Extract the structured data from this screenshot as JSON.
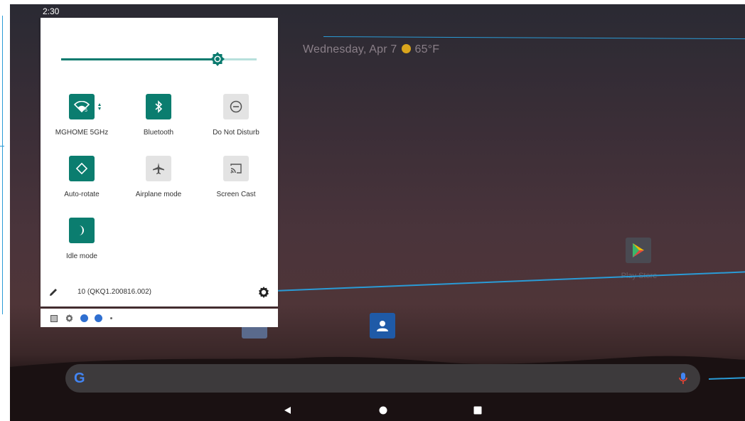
{
  "status_bar": {
    "time": "2:30"
  },
  "home": {
    "date_weather": "Wednesday, Apr 7",
    "temperature": "65°F",
    "apps": [
      {
        "label": "Play Store"
      }
    ]
  },
  "quick_settings": {
    "brightness_level": 0.8,
    "tiles": [
      {
        "label": "MGHOME 5GHz",
        "icon": "wifi-icon",
        "state": "on"
      },
      {
        "label": "Bluetooth",
        "icon": "bluetooth-icon",
        "state": "on"
      },
      {
        "label": "Do Not Disturb",
        "icon": "dnd-icon",
        "state": "off"
      },
      {
        "label": "Auto-rotate",
        "icon": "rotate-icon",
        "state": "on"
      },
      {
        "label": "Airplane mode",
        "icon": "airplane-icon",
        "state": "off"
      },
      {
        "label": "Screen Cast",
        "icon": "cast-icon",
        "state": "off"
      },
      {
        "label": "Idle mode",
        "icon": "moon-icon",
        "state": "on"
      }
    ],
    "build_number": "10 (QKQ1.200816.002)"
  },
  "colors": {
    "accent": "#0b7d6f",
    "annotation_line": "#2a9bd6"
  }
}
